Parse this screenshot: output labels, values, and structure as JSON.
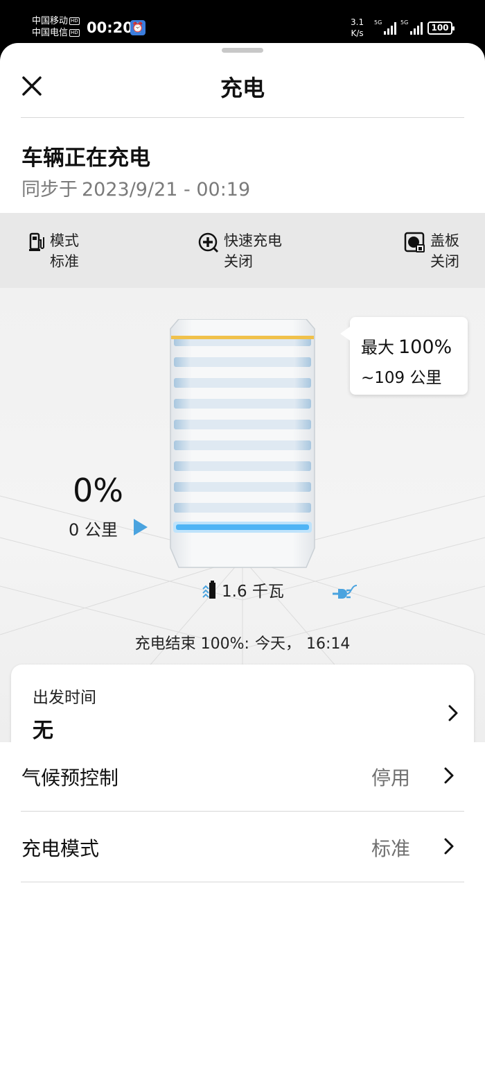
{
  "status_bar": {
    "carrier_1": "中国移动",
    "carrier_2": "中国电信",
    "hd_badge": "HD",
    "time": "00:20",
    "net_speed_value": "3.1",
    "net_speed_unit": "K/s",
    "signal_1_label": "5G",
    "signal_2_label": "5G",
    "battery": "100"
  },
  "header": {
    "title": "充电",
    "close_icon": "close-icon"
  },
  "status": {
    "headline": "车辆正在充电",
    "sync_prefix": "同步于",
    "sync_time": "2023/9/21 - 00:19"
  },
  "info_row": [
    {
      "icon": "charging-station-icon",
      "label": "模式",
      "value": "标准"
    },
    {
      "icon": "fast-charge-icon",
      "label": "快速充电",
      "value": "关闭"
    },
    {
      "icon": "charge-flap-icon",
      "label": "盖板",
      "value": "关闭"
    }
  ],
  "charging": {
    "current_percent": "0%",
    "current_range": "0 公里",
    "current_level_fraction": 0.0,
    "max_label": "最大",
    "max_percent": "100%",
    "max_range": "~109 公里",
    "power": "1.6 千瓦",
    "end_label": "充电结束 100%:",
    "end_day": "今天，",
    "end_time": "16:14"
  },
  "departure": {
    "label": "出发时间",
    "value": "无"
  },
  "settings": [
    {
      "label": "气候预控制",
      "value": "停用"
    },
    {
      "label": "充电模式",
      "value": "标准"
    }
  ],
  "colors": {
    "accent_blue": "#4aa3df",
    "max_line": "#f0c14b",
    "panel_gray": "#e8e8e8"
  }
}
